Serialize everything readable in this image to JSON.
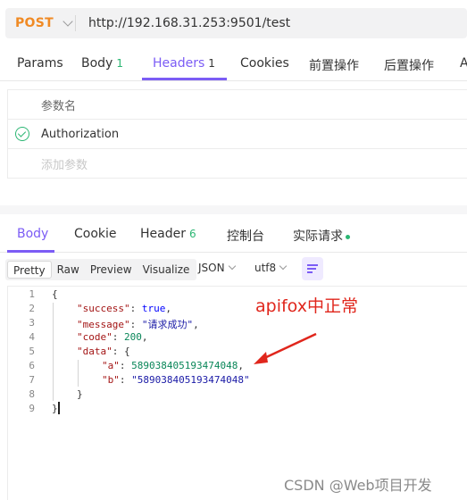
{
  "request": {
    "method": "POST",
    "url": "http://192.168.31.253:9501/test"
  },
  "request_tabs": [
    {
      "label": "Params",
      "count": ""
    },
    {
      "label": "Body",
      "count": "1"
    },
    {
      "label": "Headers",
      "count": "1"
    },
    {
      "label": "Cookies",
      "count": ""
    },
    {
      "label": "前置操作",
      "count": ""
    },
    {
      "label": "后置操作",
      "count": ""
    },
    {
      "label": "A",
      "count": ""
    }
  ],
  "params": {
    "header": "参数名",
    "rows": [
      {
        "name": "Authorization",
        "checked": true
      }
    ],
    "add_placeholder": "添加参数"
  },
  "response_tabs": [
    {
      "label": "Body",
      "count": ""
    },
    {
      "label": "Cookie",
      "count": ""
    },
    {
      "label": "Header",
      "count": "6"
    },
    {
      "label": "控制台",
      "count": ""
    },
    {
      "label": "实际请求",
      "count": ""
    }
  ],
  "toolbar": {
    "views": [
      "Pretty",
      "Raw",
      "Preview",
      "Visualize"
    ],
    "format": "JSON",
    "encoding": "utf8"
  },
  "code_lines": [
    "1",
    "2",
    "3",
    "4",
    "5",
    "6",
    "7",
    "8",
    "9"
  ],
  "response_json": {
    "success_key": "\"success\"",
    "success_val": "true",
    "message_key": "\"message\"",
    "message_val": "\"请求成功\"",
    "code_key": "\"code\"",
    "code_val": "200",
    "data_key": "\"data\"",
    "a_key": "\"a\"",
    "a_val": "589038405193474048",
    "b_key": "\"b\"",
    "b_val": "\"589038405193474048\""
  },
  "annotation": "apifox中正常",
  "watermark": "CSDN @Web项目开发",
  "colors": {
    "accent": "#7b5cf5",
    "method": "#f08a24",
    "success": "#2bb673",
    "annotation": "#e0261c"
  }
}
